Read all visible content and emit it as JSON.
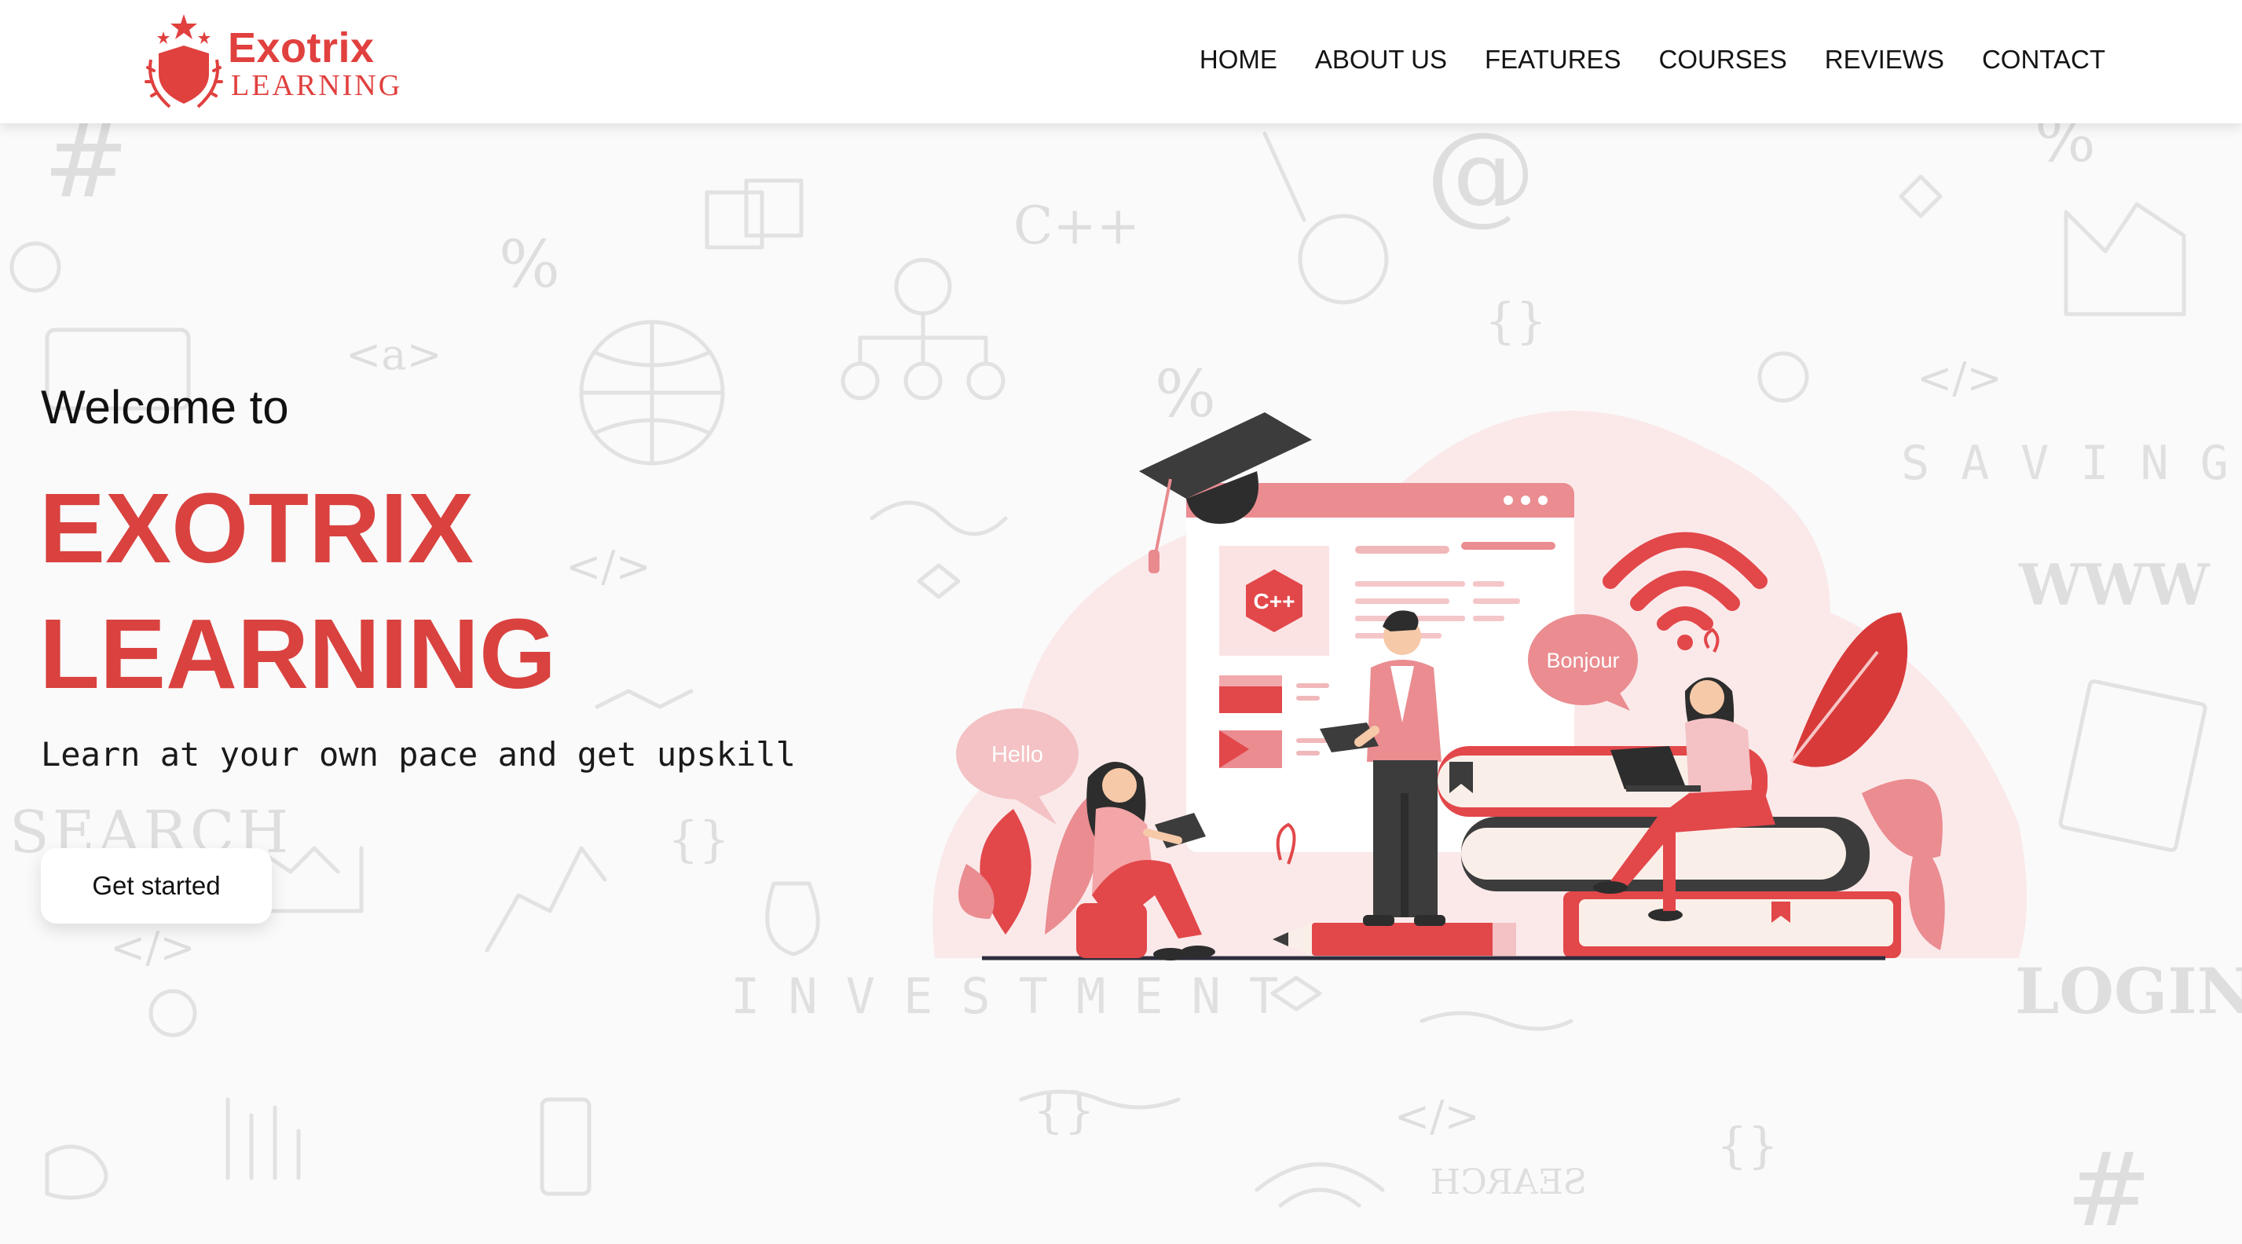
{
  "brand": {
    "name": "Exotrix",
    "sub": "LEARNING"
  },
  "nav": {
    "items": [
      {
        "label": "HOME",
        "key": "home"
      },
      {
        "label": "ABOUT US",
        "key": "about-us"
      },
      {
        "label": "FEATURES",
        "key": "features"
      },
      {
        "label": "COURSES",
        "key": "courses"
      },
      {
        "label": "REVIEWS",
        "key": "reviews"
      },
      {
        "label": "CONTACT",
        "key": "contact"
      }
    ]
  },
  "hero": {
    "welcome": "Welcome to",
    "title_line1": "EXOTRIX",
    "title_line2": "LEARNING",
    "tagline": "Learn at your own pace and get upskill",
    "cta_label": "Get started"
  },
  "illustration": {
    "bubble_hello": "Hello",
    "bubble_bonjour": "Bonjour",
    "window_badge": "C++"
  },
  "background_words": {
    "cpp": "C++",
    "search": "SEARCH",
    "saving": "SAVING",
    "investment": "INVESTMENT",
    "www": "WWW",
    "login": "LOGIN",
    "anchor_tag": "<a>",
    "code_tag": "</>",
    "braces": "{}",
    "percent": "%",
    "at": "@",
    "hash": "#",
    "search_mirrored": "SEARCH"
  },
  "colors": {
    "accent": "#d9423f",
    "logo_red": "#e0403e",
    "pink_soft": "#fbe9ea",
    "pink_mid": "#e98a8f",
    "dark": "#3c3c3c"
  }
}
